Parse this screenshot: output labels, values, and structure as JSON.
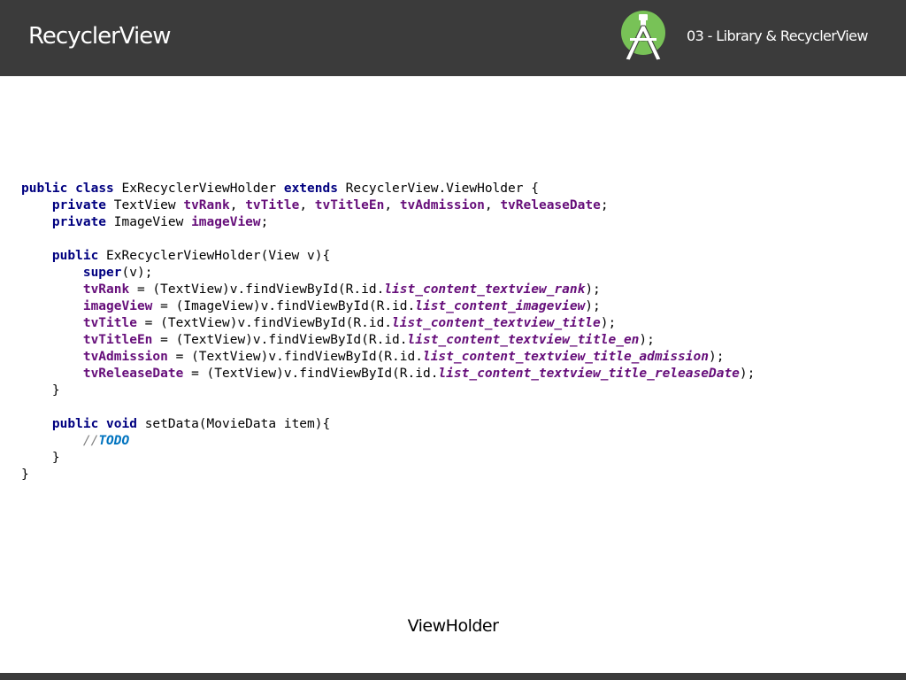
{
  "header": {
    "title": "RecyclerView",
    "section": "03 - Library & RecyclerView",
    "logo_icon": "android-studio-logo-icon"
  },
  "code": {
    "l1": {
      "a": "public",
      "b": " ",
      "c": "class",
      "d": " ExRecyclerViewHolder ",
      "e": "extends",
      "f": " RecyclerView.ViewHolder {"
    },
    "l2": {
      "a": "    ",
      "b": "private",
      "c": " TextView ",
      "d": "tvRank",
      "e": ", ",
      "f": "tvTitle",
      "g": ", ",
      "h": "tvTitleEn",
      "i": ", ",
      "j": "tvAdmission",
      "k": ", ",
      "l": "tvReleaseDate",
      "m": ";"
    },
    "l3": {
      "a": "    ",
      "b": "private",
      "c": " ImageView ",
      "d": "imageView",
      "e": ";"
    },
    "l5": {
      "a": "    ",
      "b": "public",
      "c": " ExRecyclerViewHolder(View v){"
    },
    "l6": {
      "a": "        ",
      "b": "super",
      "c": "(v);"
    },
    "l7": {
      "a": "        ",
      "b": "tvRank",
      "c": " = (TextView)v.findViewById(R.id.",
      "d": "list_content_textview_rank",
      "e": ");"
    },
    "l8": {
      "a": "        ",
      "b": "imageView",
      "c": " = (ImageView)v.findViewById(R.id.",
      "d": "list_content_imageview",
      "e": ");"
    },
    "l9": {
      "a": "        ",
      "b": "tvTitle",
      "c": " = (TextView)v.findViewById(R.id.",
      "d": "list_content_textview_title",
      "e": ");"
    },
    "l10": {
      "a": "        ",
      "b": "tvTitleEn",
      "c": " = (TextView)v.findViewById(R.id.",
      "d": "list_content_textview_title_en",
      "e": ");"
    },
    "l11": {
      "a": "        ",
      "b": "tvAdmission",
      "c": " = (TextView)v.findViewById(R.id.",
      "d": "list_content_textview_title_admission",
      "e": ");"
    },
    "l12": {
      "a": "        ",
      "b": "tvReleaseDate",
      "c": " = (TextView)v.findViewById(R.id.",
      "d": "list_content_textview_title_releaseDate",
      "e": ");"
    },
    "l13": {
      "a": "    }"
    },
    "l15": {
      "a": "    ",
      "b": "public",
      "c": " ",
      "d": "void",
      "e": " setData(MovieData item){"
    },
    "l16": {
      "a": "        ",
      "b": "//",
      "c": "TODO"
    },
    "l17": {
      "a": "    }"
    },
    "l18": {
      "a": "}"
    }
  },
  "caption": "ViewHolder",
  "colors": {
    "header_bg": "#3b3b3b",
    "keyword": "#000080",
    "field": "#660e7a",
    "comment": "#808080",
    "todo": "#0073bf",
    "logo_green": "#78c257"
  }
}
